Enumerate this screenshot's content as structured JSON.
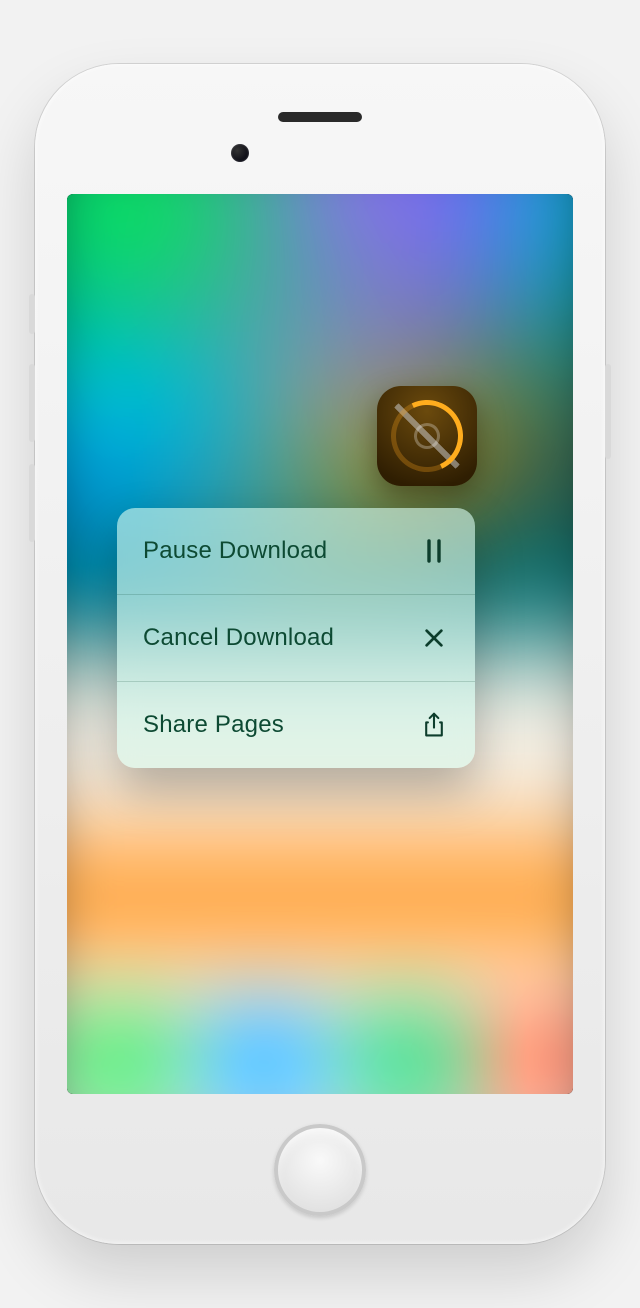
{
  "app_icon": {
    "name": "pages-app",
    "state": "downloading"
  },
  "quick_actions": {
    "items": [
      {
        "label": "Pause Download",
        "icon": "pause"
      },
      {
        "label": "Cancel Download",
        "icon": "x"
      },
      {
        "label": "Share Pages",
        "icon": "share"
      }
    ]
  }
}
